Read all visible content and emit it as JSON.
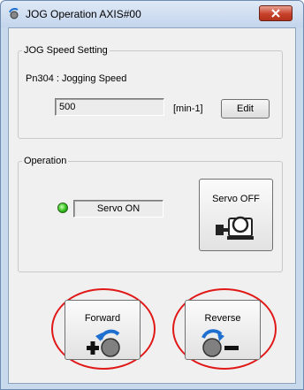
{
  "window": {
    "title": "JOG Operation AXIS#00"
  },
  "jog_speed_setting": {
    "group_label": "JOG Speed Setting",
    "param_label": "Pn304 : Jogging Speed",
    "value": "500",
    "unit": "[min-1]",
    "edit_label": "Edit"
  },
  "operation": {
    "group_label": "Operation",
    "servo_status": "Servo ON",
    "servo_toggle_label": "Servo OFF"
  },
  "jog_buttons": {
    "forward_label": "Forward",
    "reverse_label": "Reverse"
  },
  "colors": {
    "highlight_ring": "#e01818",
    "led_on": "#2fbf1a",
    "rotation_arrow": "#1f6fd0"
  }
}
